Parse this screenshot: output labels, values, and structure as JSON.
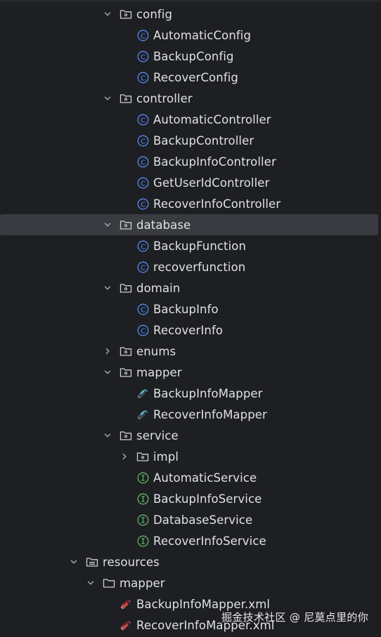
{
  "tree": [
    {
      "label": "config",
      "type": "folder",
      "expanded": true,
      "level": 0
    },
    {
      "label": "AutomaticConfig",
      "type": "class",
      "level": 1
    },
    {
      "label": "BackupConfig",
      "type": "class",
      "level": 1
    },
    {
      "label": "RecoverConfig",
      "type": "class",
      "level": 1
    },
    {
      "label": "controller",
      "type": "folder",
      "expanded": true,
      "level": 0
    },
    {
      "label": "AutomaticController",
      "type": "class",
      "level": 1
    },
    {
      "label": "BackupController",
      "type": "class",
      "level": 1
    },
    {
      "label": "BackupInfoController",
      "type": "class",
      "level": 1
    },
    {
      "label": "GetUserIdController",
      "type": "class",
      "level": 1
    },
    {
      "label": "RecoverInfoController",
      "type": "class",
      "level": 1
    },
    {
      "label": "database",
      "type": "folder",
      "expanded": true,
      "level": 0,
      "selected": true
    },
    {
      "label": "BackupFunction",
      "type": "class",
      "level": 1
    },
    {
      "label": "recoverfunction",
      "type": "class",
      "level": 1
    },
    {
      "label": "domain",
      "type": "folder",
      "expanded": true,
      "level": 0
    },
    {
      "label": "BackupInfo",
      "type": "class",
      "level": 1
    },
    {
      "label": "RecoverInfo",
      "type": "class",
      "level": 1
    },
    {
      "label": "enums",
      "type": "folder",
      "expanded": false,
      "level": 0
    },
    {
      "label": "mapper",
      "type": "folder",
      "expanded": true,
      "level": 0
    },
    {
      "label": "BackupInfoMapper",
      "type": "mapper-interface",
      "level": 1
    },
    {
      "label": "RecoverInfoMapper",
      "type": "mapper-interface",
      "level": 1
    },
    {
      "label": "service",
      "type": "folder",
      "expanded": true,
      "level": 0
    },
    {
      "label": "impl",
      "type": "folder",
      "expanded": false,
      "level": 1
    },
    {
      "label": "AutomaticService",
      "type": "interface",
      "level": 1
    },
    {
      "label": "BackupInfoService",
      "type": "interface",
      "level": 1
    },
    {
      "label": "DatabaseService",
      "type": "interface",
      "level": 1
    },
    {
      "label": "RecoverInfoService",
      "type": "interface",
      "level": 1
    },
    {
      "label": "resources",
      "type": "resources-folder",
      "expanded": true,
      "level": -2
    },
    {
      "label": "mapper",
      "type": "plain-folder",
      "expanded": true,
      "level": -1
    },
    {
      "label": "BackupInfoMapper.xml",
      "type": "mybatis-xml",
      "level": 0
    },
    {
      "label": "RecoverInfoMapper.xml",
      "type": "mybatis-xml",
      "level": 0
    }
  ],
  "watermark": "掘金技术社区 @ 尼莫点里的你",
  "colors": {
    "background": "#1e1f22",
    "selected_row": "#393b40",
    "class_icon": "#548af7",
    "interface_icon": "#5fb865",
    "text": "#dfe1e5",
    "chevron": "#a8adb5"
  }
}
